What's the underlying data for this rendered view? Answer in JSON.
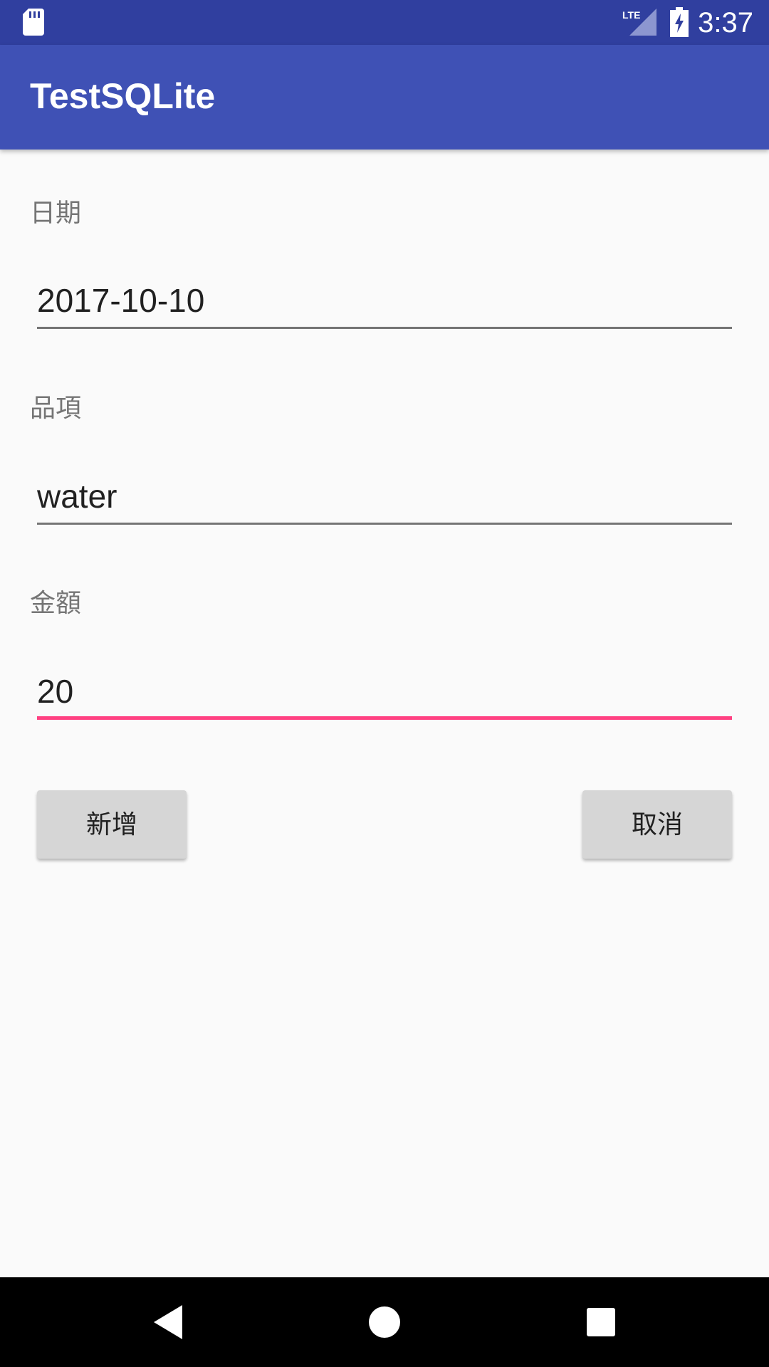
{
  "status_bar": {
    "time": "3:37",
    "network_label": "LTE",
    "icons": [
      "sd-card-icon",
      "lte-signal-icon",
      "battery-charging-icon"
    ]
  },
  "app_bar": {
    "title": "TestSQLite"
  },
  "form": {
    "date": {
      "label": "日期",
      "value": "2017-10-10"
    },
    "item": {
      "label": "品項",
      "value": "water"
    },
    "amount": {
      "label": "金額",
      "value": "20"
    }
  },
  "buttons": {
    "add_label": "新增",
    "cancel_label": "取消"
  },
  "nav_bar": {
    "icons": [
      "back-icon",
      "home-icon",
      "recents-icon"
    ]
  },
  "colors": {
    "status_bar": "#303f9f",
    "app_bar": "#3f51b5",
    "accent": "#ff4081",
    "background": "#fafafa",
    "button": "#d6d6d6"
  }
}
